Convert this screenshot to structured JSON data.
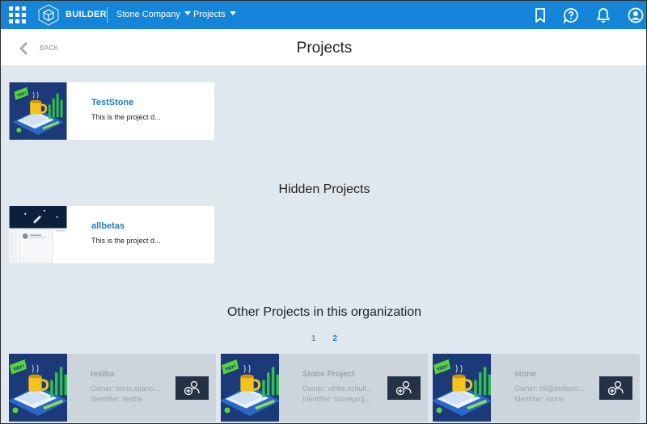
{
  "topbar": {
    "brand": "BUILDER",
    "company": "Stone Company",
    "projects_menu": "Projects",
    "bg_color": "#1485d9"
  },
  "header": {
    "back_label": "BACK",
    "title": "Projects"
  },
  "my_projects": [
    {
      "name": "TestStone",
      "description": "This is the project d...",
      "thumbnail": "isometric-illustration"
    }
  ],
  "hidden_section": {
    "title": "Hidden Projects",
    "projects": [
      {
        "name": "allbetas",
        "description": "This is the project d...",
        "thumbnail": "website-screenshot"
      }
    ]
  },
  "other_section": {
    "title": "Other Projects in this organization",
    "pages": [
      "1",
      "2"
    ],
    "current_page": "2",
    "projects": [
      {
        "name": "testba",
        "owner": "Owner: boris.aljanci...",
        "identifier": "Identifier: testba"
      },
      {
        "name": "Stone Project",
        "owner": "Owner: ulrike.schull...",
        "identifier": "Identifier: stoneproj..."
      },
      {
        "name": "stone",
        "owner": "Owner: till@deltaon...",
        "identifier": "Identifier: stone"
      }
    ],
    "join_icon": "add-user-icon"
  }
}
